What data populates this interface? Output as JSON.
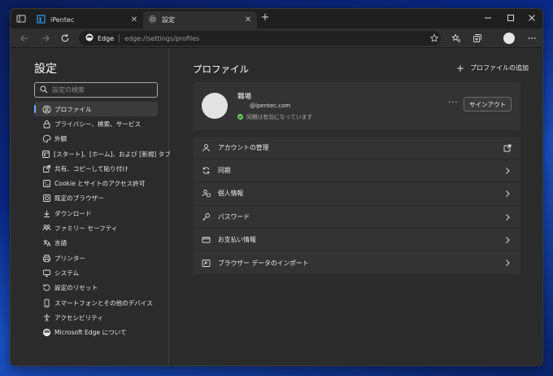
{
  "tabs": [
    {
      "title": "iPentec",
      "active": false
    },
    {
      "title": "設定",
      "active": true
    }
  ],
  "toolbar": {
    "brand": "Edge",
    "url": "edge://settings/profiles"
  },
  "sidebar": {
    "title": "設定",
    "search_placeholder": "設定の検索",
    "items": [
      {
        "label": "プロファイル",
        "icon": "profile-icon",
        "active": true
      },
      {
        "label": "プライバシー、検索、サービス",
        "icon": "lock-icon"
      },
      {
        "label": "外観",
        "icon": "appearance-icon"
      },
      {
        "label": "[スタート]、[ホーム]、および [新規] タブ",
        "icon": "start-home-icon"
      },
      {
        "label": "共有、コピーして貼り付け",
        "icon": "share-icon"
      },
      {
        "label": "Cookie とサイトのアクセス許可",
        "icon": "cookie-permissions-icon"
      },
      {
        "label": "既定のブラウザー",
        "icon": "default-browser-icon"
      },
      {
        "label": "ダウンロード",
        "icon": "download-icon"
      },
      {
        "label": "ファミリー セーフティ",
        "icon": "family-icon"
      },
      {
        "label": "言語",
        "icon": "language-icon"
      },
      {
        "label": "プリンター",
        "icon": "printer-icon"
      },
      {
        "label": "システム",
        "icon": "system-icon"
      },
      {
        "label": "設定のリセット",
        "icon": "reset-icon"
      },
      {
        "label": "スマートフォンとその他のデバイス",
        "icon": "phone-icon"
      },
      {
        "label": "アクセシビリティ",
        "icon": "accessibility-icon"
      },
      {
        "label": "Microsoft Edge について",
        "icon": "edge-logo-icon"
      }
    ]
  },
  "main": {
    "title": "プロファイル",
    "add_profile": "プロファイルの追加",
    "profile": {
      "name": "職場",
      "email": "@ipentec.com",
      "sync_status": "同期は有効になっています",
      "more": "···",
      "signout": "サインアウト"
    },
    "settings": [
      {
        "label": "アカウントの管理",
        "icon": "account-icon",
        "action": "external"
      },
      {
        "label": "同期",
        "icon": "sync-icon",
        "action": "chevron"
      },
      {
        "label": "個人情報",
        "icon": "personal-info-icon",
        "action": "chevron"
      },
      {
        "label": "パスワード",
        "icon": "key-icon",
        "action": "chevron"
      },
      {
        "label": "お支払い情報",
        "icon": "card-icon",
        "action": "chevron"
      },
      {
        "label": "ブラウザー データのインポート",
        "icon": "import-icon",
        "action": "chevron"
      }
    ]
  },
  "colors": {
    "background": "#2b2b2b",
    "card": "#333333",
    "accent": "#6cb0ff",
    "sync_ok": "#6ccb5f"
  }
}
